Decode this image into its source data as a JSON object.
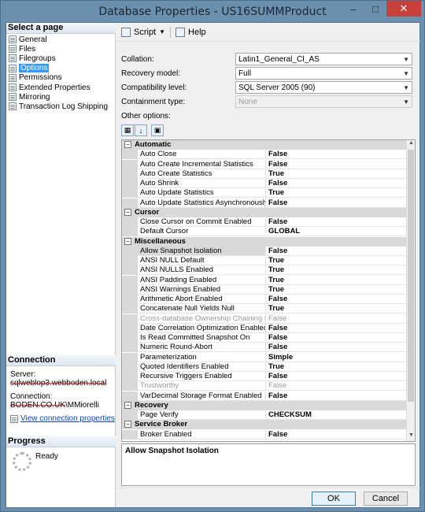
{
  "window": {
    "title": "Database Properties - US16SUMMProduct"
  },
  "left_pane": {
    "select_page_title": "Select a page",
    "pages": [
      {
        "label": "General",
        "selected": false
      },
      {
        "label": "Files",
        "selected": false
      },
      {
        "label": "Filegroups",
        "selected": false
      },
      {
        "label": "Options",
        "selected": true
      },
      {
        "label": "Permissions",
        "selected": false
      },
      {
        "label": "Extended Properties",
        "selected": false
      },
      {
        "label": "Mirroring",
        "selected": false
      },
      {
        "label": "Transaction Log Shipping",
        "selected": false
      }
    ],
    "connection_title": "Connection",
    "server_label": "Server:",
    "server_value": "sqlweblop3.webboden.local",
    "connection_label": "Connection:",
    "connection_value_struck": "BODEN.CO.UK",
    "connection_value_rest": "\\MMiorelli",
    "view_connection_link": "View connection properties",
    "progress_title": "Progress",
    "progress_status": "Ready"
  },
  "toolbar": {
    "script_label": "Script",
    "help_label": "Help"
  },
  "fields": {
    "collation": {
      "label": "Collation:",
      "value": "Latin1_General_CI_AS"
    },
    "recovery_model": {
      "label": "Recovery model:",
      "value": "Full"
    },
    "compatibility_level": {
      "label": "Compatibility level:",
      "value": "SQL Server 2005 (90)"
    },
    "containment_type": {
      "label": "Containment type:",
      "value": "None"
    }
  },
  "other_options_label": "Other options:",
  "grid": {
    "categories": [
      {
        "name": "Automatic",
        "rows": [
          {
            "name": "Auto Close",
            "value": "False"
          },
          {
            "name": "Auto Create Incremental Statistics",
            "value": "False"
          },
          {
            "name": "Auto Create Statistics",
            "value": "True"
          },
          {
            "name": "Auto Shrink",
            "value": "False"
          },
          {
            "name": "Auto Update Statistics",
            "value": "True"
          },
          {
            "name": "Auto Update Statistics Asynchronously",
            "value": "False"
          }
        ]
      },
      {
        "name": "Cursor",
        "rows": [
          {
            "name": "Close Cursor on Commit Enabled",
            "value": "False"
          },
          {
            "name": "Default Cursor",
            "value": "GLOBAL"
          }
        ]
      },
      {
        "name": "Miscellaneous",
        "rows": [
          {
            "name": "Allow Snapshot Isolation",
            "value": "False",
            "selected": true
          },
          {
            "name": "ANSI NULL Default",
            "value": "True"
          },
          {
            "name": "ANSI NULLS Enabled",
            "value": "True"
          },
          {
            "name": "ANSI Padding Enabled",
            "value": "True"
          },
          {
            "name": "ANSI Warnings Enabled",
            "value": "True"
          },
          {
            "name": "Arithmetic Abort Enabled",
            "value": "False"
          },
          {
            "name": "Concatenate Null Yields Null",
            "value": "True"
          },
          {
            "name": "Cross-database Ownership Chaining Enabled",
            "value": "False",
            "disabled": true
          },
          {
            "name": "Date Correlation Optimization Enabled",
            "value": "False"
          },
          {
            "name": "Is Read Committed Snapshot On",
            "value": "False"
          },
          {
            "name": "Numeric Round-Abort",
            "value": "False"
          },
          {
            "name": "Parameterization",
            "value": "Simple"
          },
          {
            "name": "Quoted Identifiers Enabled",
            "value": "True"
          },
          {
            "name": "Recursive Triggers Enabled",
            "value": "False"
          },
          {
            "name": "Trustworthy",
            "value": "False",
            "disabled": true
          },
          {
            "name": "VarDecimal Storage Format Enabled",
            "value": "False"
          }
        ]
      },
      {
        "name": "Recovery",
        "rows": [
          {
            "name": "Page Verify",
            "value": "CHECKSUM"
          }
        ]
      },
      {
        "name": "Service Broker",
        "rows": [
          {
            "name": "Broker Enabled",
            "value": "False"
          }
        ]
      }
    ]
  },
  "description": {
    "text": "Allow Snapshot Isolation"
  },
  "buttons": {
    "ok": "OK",
    "cancel": "Cancel"
  }
}
